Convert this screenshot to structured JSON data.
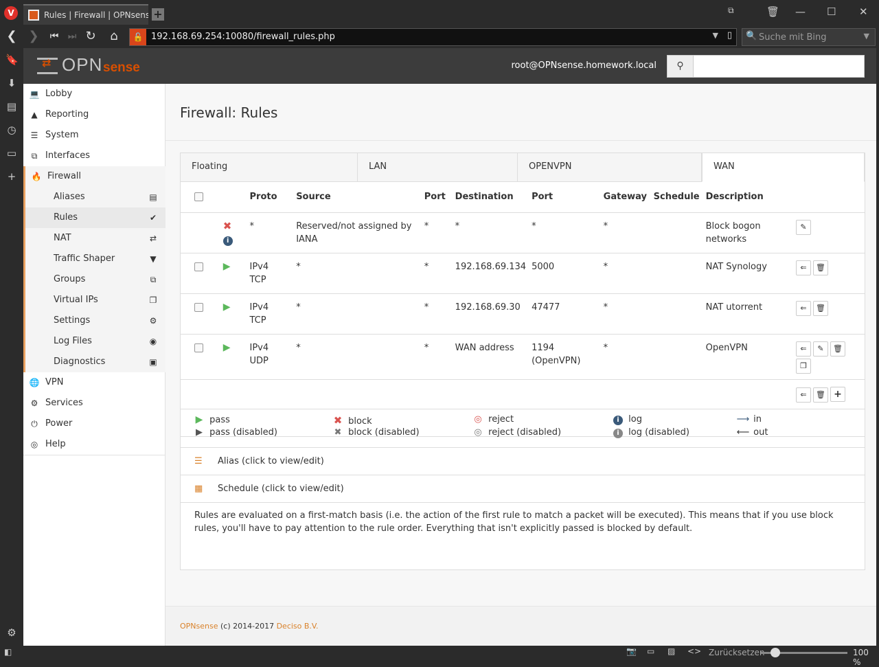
{
  "browser": {
    "tab_title": "Rules | Firewall | OPNsense.h",
    "url": "192.168.69.254:10080/firewall_rules.php",
    "search_placeholder": "Suche mit Bing",
    "reset_label": "Zurücksetzen",
    "zoom": "100 %"
  },
  "header": {
    "logo_main": "OPN",
    "logo_sub": "sense",
    "user": "root@OPNsense.homework.local",
    "search_value": ""
  },
  "sidebar": {
    "items": [
      {
        "label": "Lobby",
        "icon": "laptop-icon"
      },
      {
        "label": "Reporting",
        "icon": "area-chart-icon"
      },
      {
        "label": "System",
        "icon": "server-icon"
      },
      {
        "label": "Interfaces",
        "icon": "sitemap-icon"
      },
      {
        "label": "Firewall",
        "icon": "fire-icon"
      },
      {
        "label": "VPN",
        "icon": "globe-icon"
      },
      {
        "label": "Services",
        "icon": "cog-icon"
      },
      {
        "label": "Power",
        "icon": "plug-icon"
      },
      {
        "label": "Help",
        "icon": "life-ring-icon"
      }
    ],
    "firewall_sub": [
      {
        "label": "Aliases"
      },
      {
        "label": "Rules"
      },
      {
        "label": "NAT"
      },
      {
        "label": "Traffic Shaper"
      },
      {
        "label": "Groups"
      },
      {
        "label": "Virtual IPs"
      },
      {
        "label": "Settings"
      },
      {
        "label": "Log Files"
      },
      {
        "label": "Diagnostics"
      }
    ]
  },
  "main": {
    "title": "Firewall: Rules",
    "tabs": [
      {
        "label": "Floating"
      },
      {
        "label": "LAN"
      },
      {
        "label": "OPENVPN"
      },
      {
        "label": "WAN"
      }
    ],
    "active_tab": "WAN",
    "columns": [
      "Proto",
      "Source",
      "Port",
      "Destination",
      "Port",
      "Gateway",
      "Schedule",
      "Description"
    ],
    "rules": [
      {
        "proto1": "*",
        "proto2": "",
        "source": "Reserved/not assigned by IANA",
        "sport": "*",
        "dest": "*",
        "dport1": "*",
        "dport2": "",
        "gateway": "*",
        "schedule": "",
        "desc": "Block bogon networks"
      },
      {
        "proto1": "IPv4",
        "proto2": "TCP",
        "source": "*",
        "sport": "*",
        "dest": "192.168.69.134",
        "dport1": "5000",
        "dport2": "",
        "gateway": "*",
        "schedule": "",
        "desc": "NAT Synology"
      },
      {
        "proto1": "IPv4",
        "proto2": "TCP",
        "source": "*",
        "sport": "*",
        "dest": "192.168.69.30",
        "dport1": "47477",
        "dport2": "",
        "gateway": "*",
        "schedule": "",
        "desc": "NAT utorrent"
      },
      {
        "proto1": "IPv4",
        "proto2": "UDP",
        "source": "*",
        "sport": "*",
        "dest": "WAN address",
        "dport1": "1194",
        "dport2": "(OpenVPN)",
        "gateway": "*",
        "schedule": "",
        "desc": "OpenVPN"
      }
    ],
    "legend": {
      "pass": "pass",
      "pass_disabled": "pass (disabled)",
      "block": "block",
      "block_disabled": "block (disabled)",
      "reject": "reject",
      "reject_disabled": "reject (disabled)",
      "log": "log",
      "log_disabled": "log (disabled)",
      "in": "in",
      "out": "out"
    },
    "alias_label": "Alias (click to view/edit)",
    "schedule_label": "Schedule (click to view/edit)",
    "note": "Rules are evaluated on a first-match basis (i.e. the action of the first rule to match a packet will be executed). This means that if you use block rules, you'll have to pay attention to the rule order. Everything that isn't explicitly passed is blocked by default."
  },
  "footer": {
    "brand": "OPNsense",
    "copy": " (c) 2014-2017 ",
    "company": "Deciso B.V."
  }
}
